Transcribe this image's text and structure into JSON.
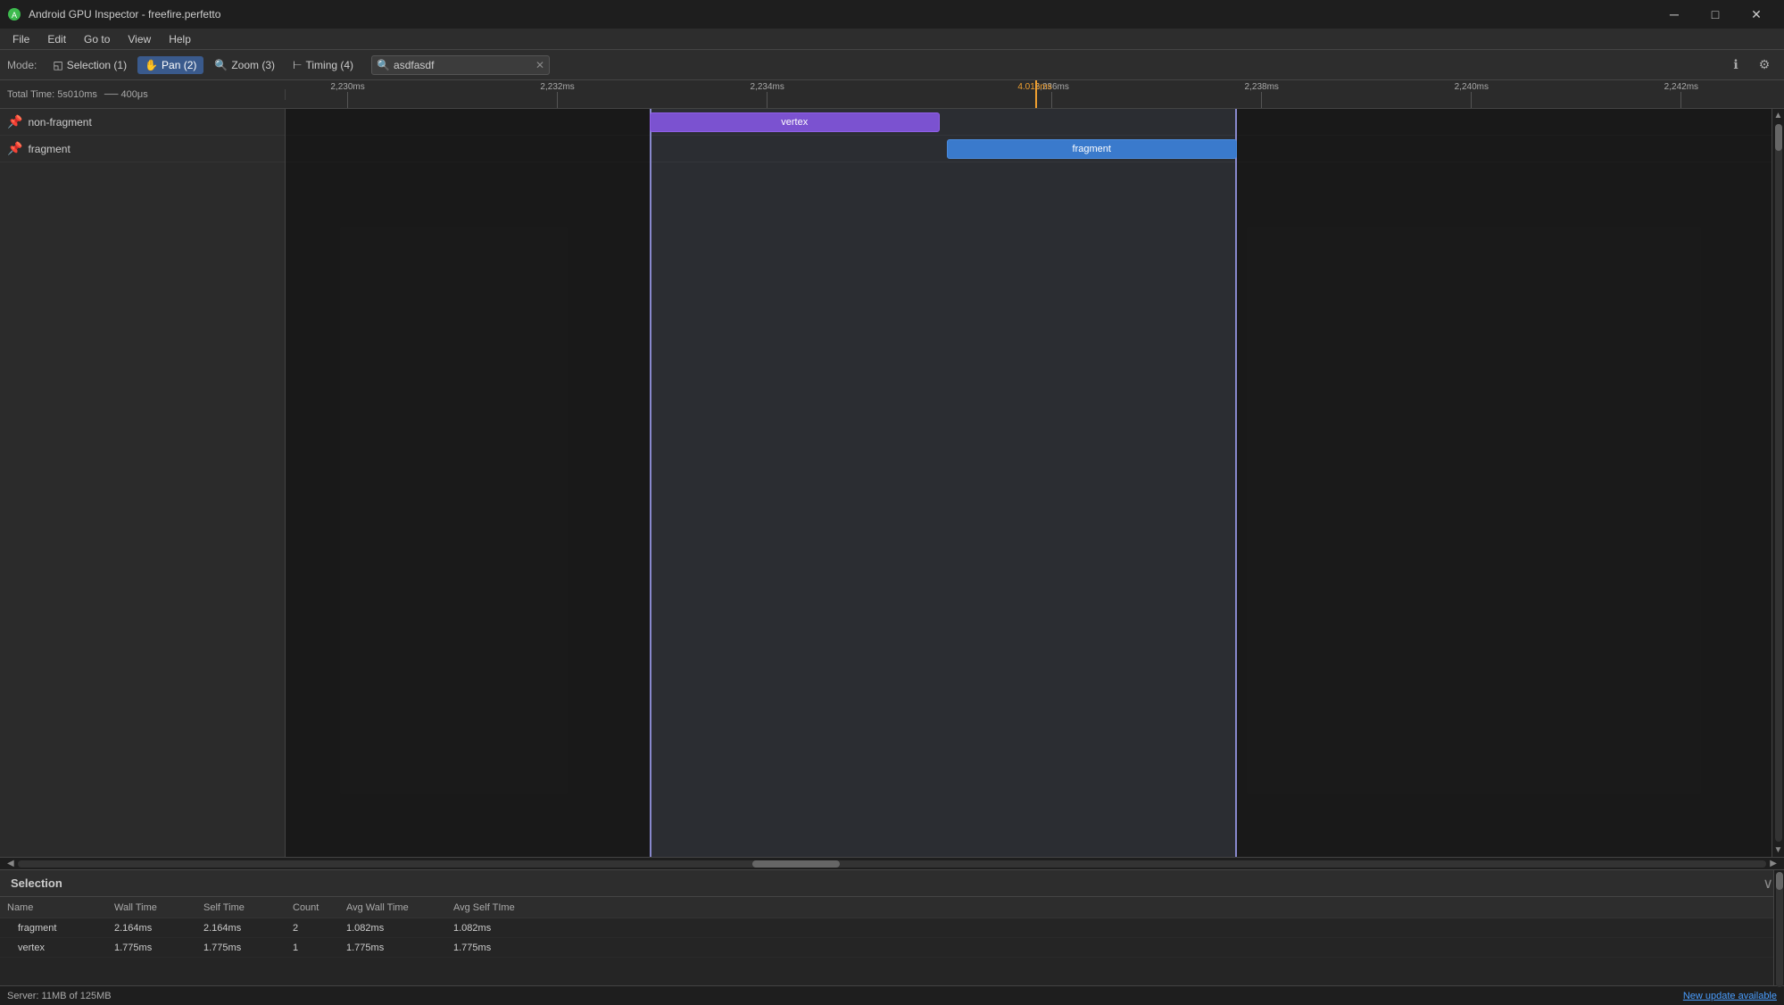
{
  "window": {
    "title": "Android GPU Inspector - freefire.perfetto",
    "app_icon": "android-icon"
  },
  "title_bar": {
    "minimize_label": "─",
    "maximize_label": "□",
    "close_label": "✕"
  },
  "menu": {
    "items": [
      "File",
      "Edit",
      "Go to",
      "View",
      "Help"
    ]
  },
  "toolbar": {
    "mode_label": "Mode:",
    "modes": [
      {
        "label": "Selection (1)",
        "key": "selection",
        "active": false,
        "icon": "◱"
      },
      {
        "label": "Pan (2)",
        "key": "pan",
        "active": true,
        "icon": "✋"
      },
      {
        "label": "Zoom (3)",
        "key": "zoom",
        "active": false,
        "icon": "🔍"
      },
      {
        "label": "Timing (4)",
        "key": "timing",
        "active": false,
        "icon": "⊢"
      }
    ],
    "search_value": "asdfasdf",
    "search_placeholder": "Search",
    "info_icon": "ℹ",
    "settings_icon": "⚙"
  },
  "timeline": {
    "total_time": "5s010ms",
    "scale": "400μs",
    "cursor_time": "4.016ms",
    "ticks": [
      {
        "label": "2,230ms",
        "left_pct": 3.0
      },
      {
        "label": "2,232ms",
        "left_pct": 17.0
      },
      {
        "label": "2,234ms",
        "left_pct": 31.0
      },
      {
        "label": "2,236ms",
        "left_pct": 50.0
      },
      {
        "label": "2,238ms",
        "left_pct": 64.0
      },
      {
        "label": "2,240ms",
        "left_pct": 78.0
      },
      {
        "label": "2,242ms",
        "left_pct": 92.0
      }
    ],
    "cursor_left_pct": 50.0
  },
  "tracks": [
    {
      "name": "non-fragment",
      "pinned": true,
      "blocks": [
        {
          "label": "vertex",
          "type": "vertex",
          "left_pct": 24.5,
          "width_pct": 19.5
        }
      ]
    },
    {
      "name": "fragment",
      "pinned": true,
      "blocks": [
        {
          "label": "fragment",
          "type": "fragment",
          "left_pct": 44.5,
          "width_pct": 19.5
        }
      ]
    }
  ],
  "selection": {
    "title": "Selection",
    "collapse_icon": "∨",
    "columns": [
      "Name",
      "Wall Time",
      "Self Time",
      "Count",
      "Avg Wall Time",
      "Avg Self TIme"
    ],
    "rows": [
      {
        "name": "fragment",
        "wall_time": "2.164ms",
        "self_time": "2.164ms",
        "count": "2",
        "avg_wall_time": "1.082ms",
        "avg_self_time": "1.082ms"
      },
      {
        "name": "vertex",
        "wall_time": "1.775ms",
        "self_time": "1.775ms",
        "count": "1",
        "avg_wall_time": "1.775ms",
        "avg_self_time": "1.775ms"
      }
    ]
  },
  "status_bar": {
    "server_label": "Server:",
    "server_value": "11MB of 125MB",
    "update_link": "New update available"
  },
  "scrollbar": {
    "thumb_left_pct": 42,
    "thumb_width_pct": 5
  }
}
